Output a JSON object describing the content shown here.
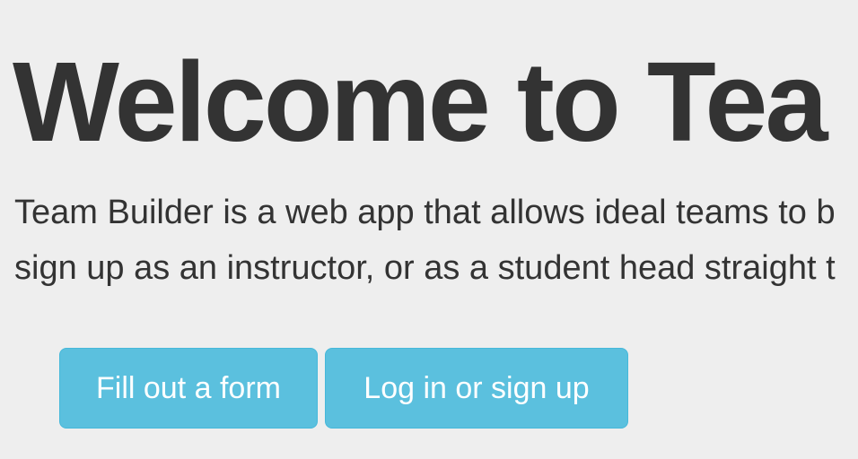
{
  "jumbotron": {
    "headline": "Welcome to Tea",
    "lead_lines": [
      "Team Builder is a web app that allows ideal teams to b",
      "sign up as an instructor, or as a student head straight t"
    ]
  },
  "actions": {
    "fill_form_label": "Fill out a form",
    "login_label": "Log in or sign up"
  },
  "colors": {
    "background": "#eeeeee",
    "text": "#333333",
    "button_bg": "#5bc0de",
    "button_border": "#46b8da",
    "button_text": "#ffffff"
  }
}
